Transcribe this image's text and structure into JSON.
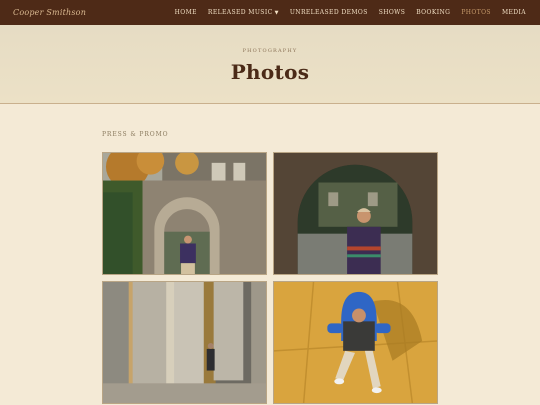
{
  "nav": {
    "brand": "Cooper Smithson",
    "items": [
      {
        "label": "HOME",
        "active": false
      },
      {
        "label": "RELEASED MUSIC",
        "active": false,
        "has_dropdown": true
      },
      {
        "label": "UNRELEASED DEMOS",
        "active": false
      },
      {
        "label": "SHOWS",
        "active": false
      },
      {
        "label": "BOOKING",
        "active": false
      },
      {
        "label": "PHOTOS",
        "active": true
      },
      {
        "label": "MEDIA",
        "active": false
      }
    ]
  },
  "hero": {
    "eyebrow": "PHOTOGRAPHY",
    "title": "Photos"
  },
  "section": {
    "label": "PRESS & PROMO"
  },
  "colors": {
    "nav_bg": "#4e2a17",
    "page_bg": "#f4ead6",
    "title": "#4b2a17",
    "active_link": "#c79b6c"
  },
  "photos": [
    {
      "subject": "stone-arch-ivy-courtyard"
    },
    {
      "subject": "portrait-under-stone-arch"
    },
    {
      "subject": "colonnade-columns"
    },
    {
      "subject": "seated-on-blue-chair"
    }
  ]
}
